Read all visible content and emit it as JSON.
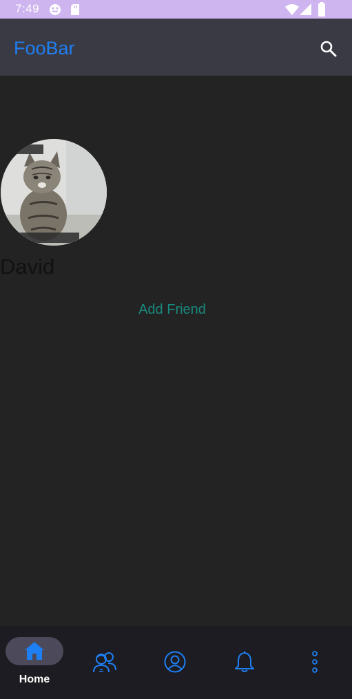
{
  "status_bar": {
    "time": "7:49",
    "icons": [
      "media-icon",
      "sd-card-icon",
      "wifi-icon",
      "signal-icon",
      "battery-icon"
    ],
    "background": "#cfb5ef"
  },
  "app_bar": {
    "title": "FooBar",
    "title_color": "#1e7ff2",
    "actions": [
      "search-icon"
    ]
  },
  "profile": {
    "name": "David",
    "avatar_icon": "cat-photo",
    "add_friend_label": "Add Friend",
    "add_friend_color": "#188a7d"
  },
  "bottom_nav": {
    "items": [
      {
        "icon": "home-icon",
        "label": "Home",
        "selected": true
      },
      {
        "icon": "friends-icon",
        "label": ""
      },
      {
        "icon": "profile-icon",
        "label": ""
      },
      {
        "icon": "bell-icon",
        "label": ""
      },
      {
        "icon": "more-vert-icon",
        "label": ""
      }
    ],
    "accent": "#1e7ff2"
  }
}
